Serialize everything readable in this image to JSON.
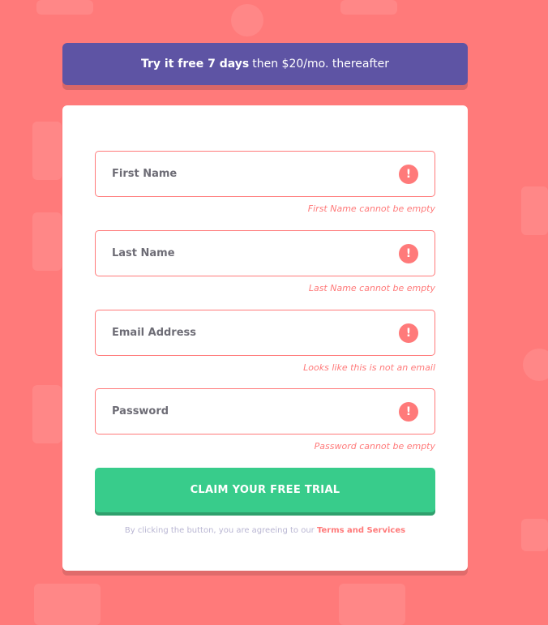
{
  "promo": {
    "bold": "Try it free 7 days",
    "rest": "then $20/mo. thereafter"
  },
  "form": {
    "fields": [
      {
        "placeholder": "First Name",
        "error": "First Name cannot be empty",
        "icon": "error-icon"
      },
      {
        "placeholder": "Last Name",
        "error": "Last Name cannot be empty",
        "icon": "error-icon"
      },
      {
        "placeholder": "Email Address",
        "error": "Looks like this is not an email",
        "icon": "error-icon"
      },
      {
        "placeholder": "Password",
        "error": "Password cannot be empty",
        "icon": "error-icon"
      }
    ],
    "error_glyph": "!",
    "submit_label": "CLAIM YOUR FREE TRIAL",
    "terms_prefix": "By clicking the button, you are agreeing to our",
    "terms_link": "Terms and Services"
  },
  "colors": {
    "background": "#ff7a7a",
    "promo": "#5e54a4",
    "submit": "#38cc8b",
    "error": "#ff7a7a"
  }
}
